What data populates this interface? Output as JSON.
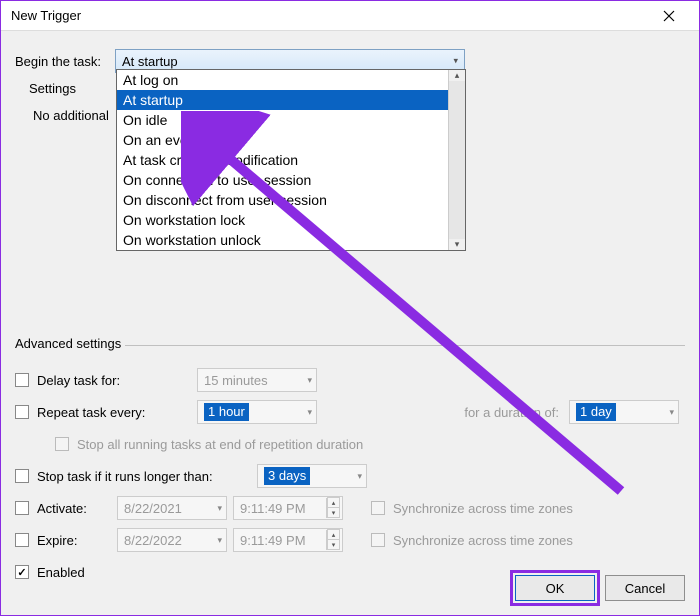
{
  "window": {
    "title": "New Trigger"
  },
  "begin": {
    "label": "Begin the task:",
    "value": "At startup",
    "options": [
      "At log on",
      "At startup",
      "On idle",
      "On an event",
      "At task creation/modification",
      "On connection to user session",
      "On disconnect from user session",
      "On workstation lock",
      "On workstation unlock"
    ],
    "selected_index": 1
  },
  "settings": {
    "label": "Settings",
    "no_additional": "No additional settings required."
  },
  "advanced": {
    "legend": "Advanced settings",
    "delay_label": "Delay task for:",
    "delay_value": "15 minutes",
    "repeat_label": "Repeat task every:",
    "repeat_value": "1 hour",
    "duration_label": "for a duration of:",
    "duration_value": "1 day",
    "stop_all_label": "Stop all running tasks at end of repetition duration",
    "stop_if_label": "Stop task if it runs longer than:",
    "stop_if_value": "3 days",
    "activate_label": "Activate:",
    "activate_date": "8/22/2021",
    "activate_time": "9:11:49 PM",
    "expire_label": "Expire:",
    "expire_date": "8/22/2022",
    "expire_time": "9:11:49 PM",
    "sync_label": "Synchronize across time zones",
    "enabled_label": "Enabled"
  },
  "buttons": {
    "ok": "OK",
    "cancel": "Cancel"
  },
  "colors": {
    "annotation": "#8a2be2",
    "selection": "#0a63c2"
  }
}
